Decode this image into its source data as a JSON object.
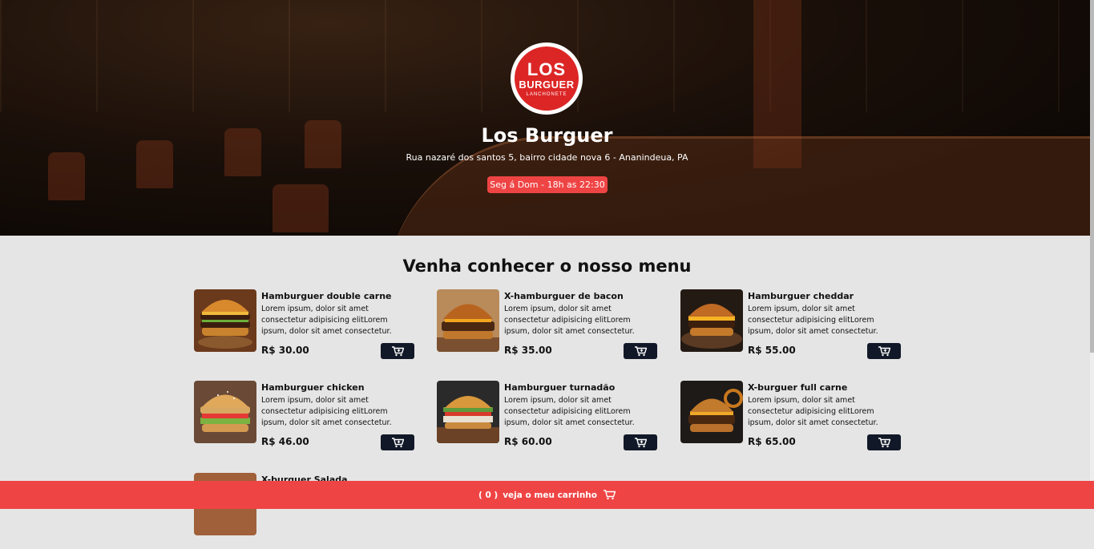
{
  "hero": {
    "logo_line1": "LOS",
    "logo_line2": "BURGUER",
    "logo_line3": "LANCHONETE",
    "title": "Los Burguer",
    "address": "Rua nazaré dos santos 5, bairro cidade nova 6 - Ananindeua, PA",
    "hours": "Seg á Dom - 18h as 22:30"
  },
  "menu": {
    "title": "Venha conhecer o nosso menu",
    "items": [
      {
        "name": "Hamburguer double carne",
        "description": "Lorem ipsum, dolor sit amet consectetur adipisicing elitLorem ipsum, dolor sit amet consectetur.",
        "price": "R$ 30.00",
        "icon": "cart-plus-icon"
      },
      {
        "name": "X-hamburguer de bacon",
        "description": "Lorem ipsum, dolor sit amet consectetur adipisicing elitLorem ipsum, dolor sit amet consectetur.",
        "price": "R$ 35.00",
        "icon": "cart-plus-icon"
      },
      {
        "name": "Hamburguer cheddar",
        "description": "Lorem ipsum, dolor sit amet consectetur adipisicing elitLorem ipsum, dolor sit amet consectetur.",
        "price": "R$ 55.00",
        "icon": "cart-plus-icon"
      },
      {
        "name": "Hamburguer chicken",
        "description": "Lorem ipsum, dolor sit amet consectetur adipisicing elitLorem ipsum, dolor sit amet consectetur.",
        "price": "R$ 46.00",
        "icon": "cart-plus-icon"
      },
      {
        "name": "Hamburguer turnadão",
        "description": "Lorem ipsum, dolor sit amet consectetur adipisicing elitLorem ipsum, dolor sit amet consectetur.",
        "price": "R$ 60.00",
        "icon": "cart-plus-icon"
      },
      {
        "name": "X-burguer full carne",
        "description": "Lorem ipsum, dolor sit amet consectetur adipisicing elitLorem ipsum, dolor sit amet consectetur.",
        "price": "R$ 65.00",
        "icon": "cart-plus-icon"
      },
      {
        "name": "X-burguer Salada"
      }
    ]
  },
  "footer": {
    "count": "( 0 )",
    "label": "veja o meu carrinho",
    "icon": "cart-icon"
  },
  "colors": {
    "accent": "#ef4444",
    "button_dark": "#111827",
    "background": "#e5e5e5"
  }
}
